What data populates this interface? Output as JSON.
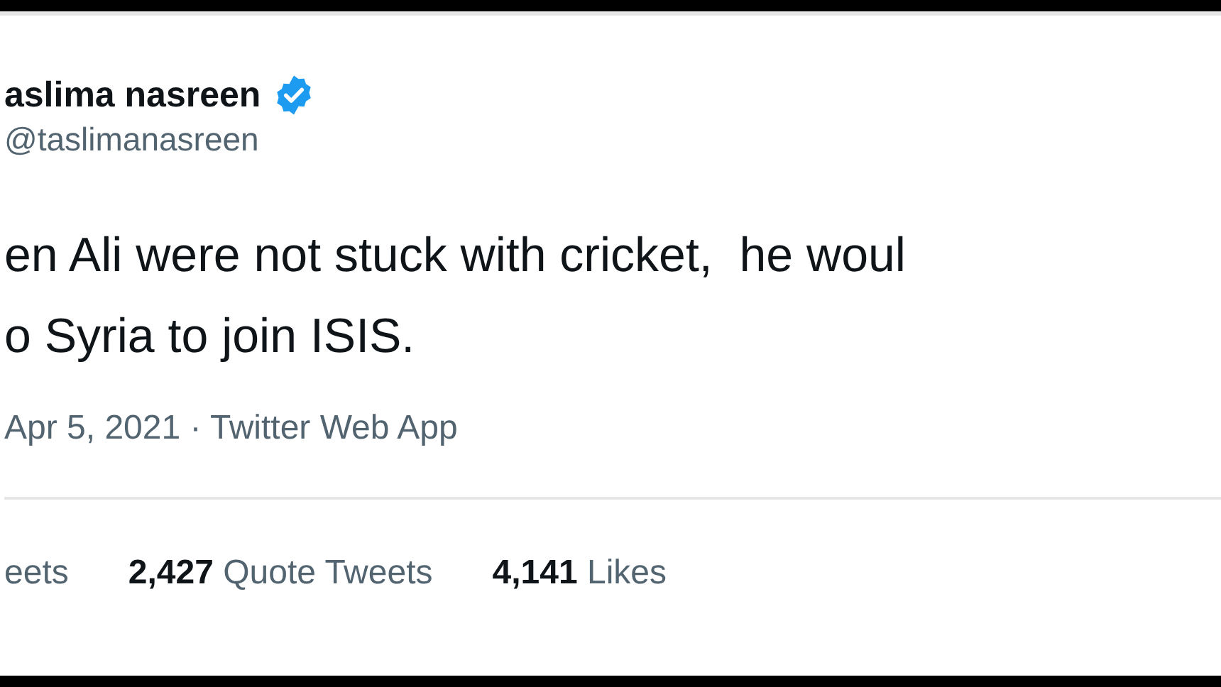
{
  "author": {
    "name": "aslima nasreen",
    "verified": true,
    "handle": "@taslimanasreen"
  },
  "text_lines": [
    "en Ali were not stuck with cricket,  he woul",
    "o Syria to join ISIS."
  ],
  "meta": "Apr 5, 2021 · Twitter Web App",
  "stats": [
    {
      "label": "eets"
    },
    {
      "count": "2,427",
      "label": "Quote Tweets"
    },
    {
      "count": "4,141",
      "label": "Likes"
    }
  ]
}
